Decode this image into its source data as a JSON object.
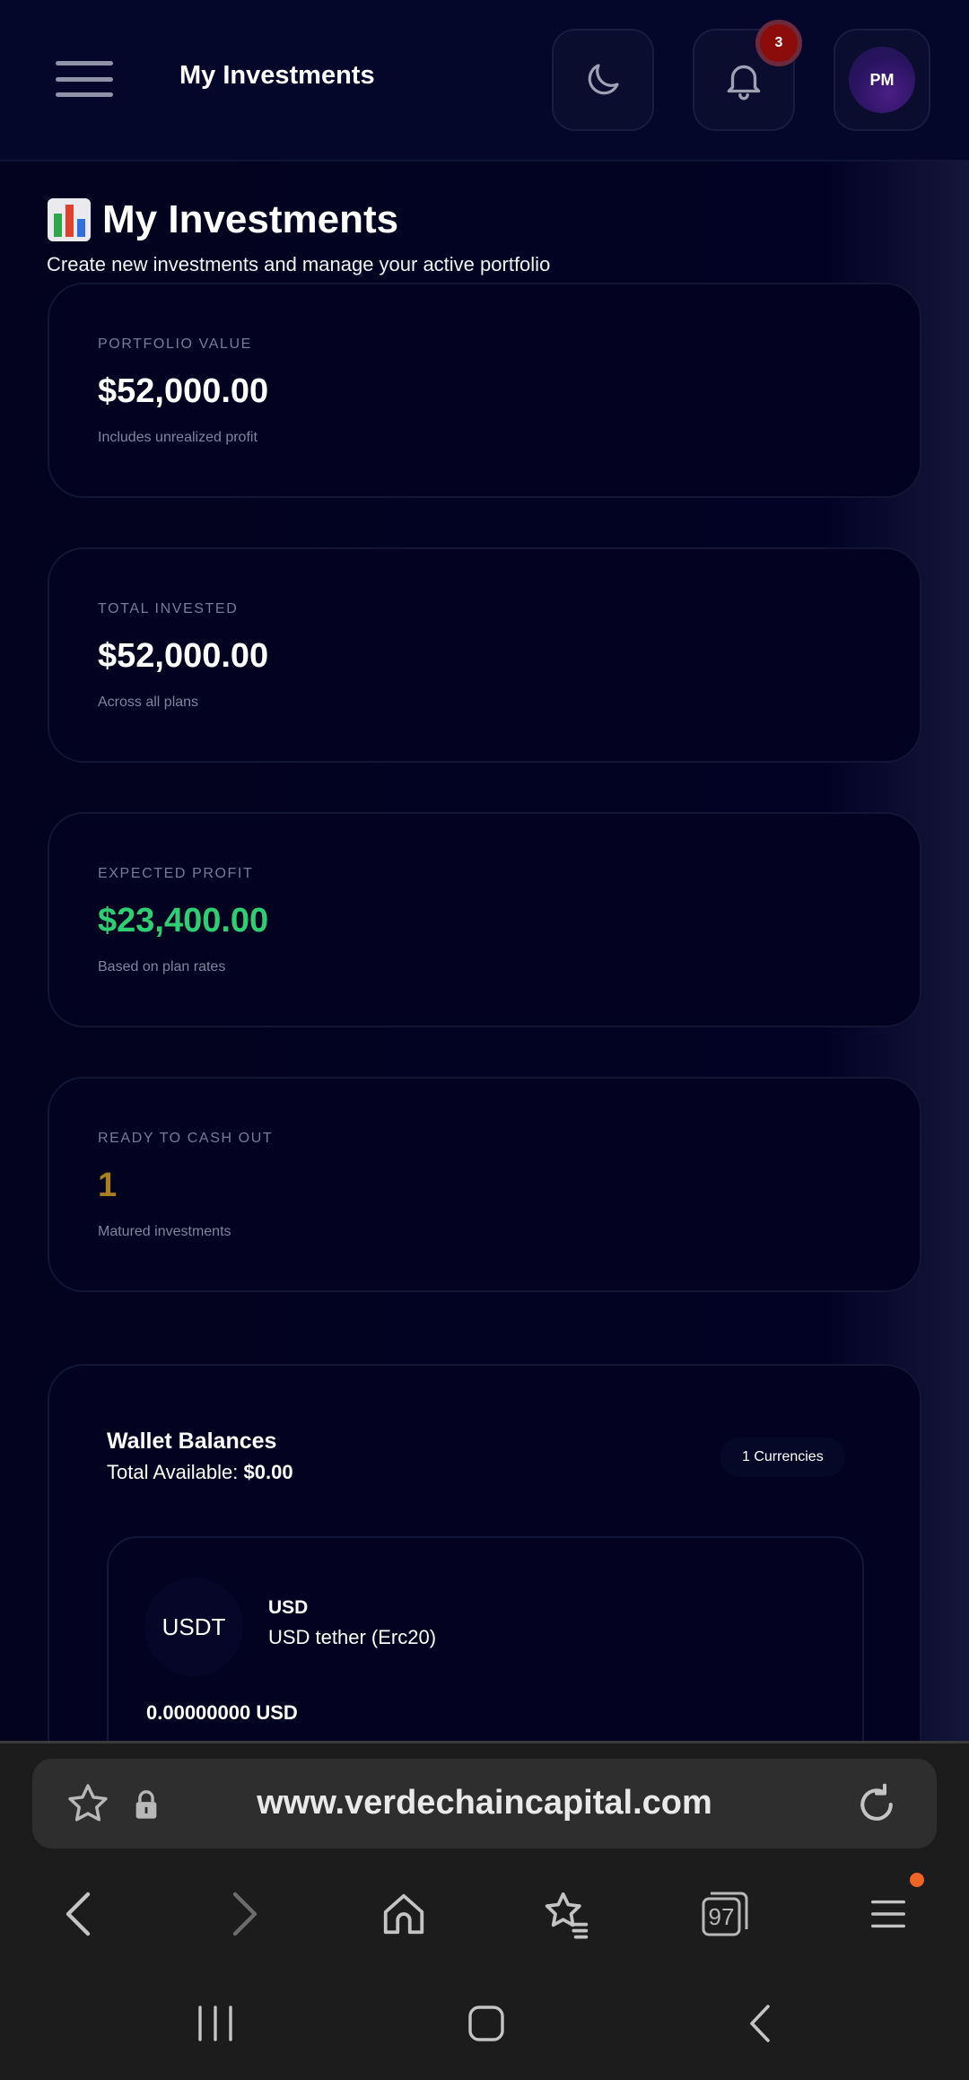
{
  "header": {
    "title": "My Investments",
    "notifications_count": "3",
    "avatar_initials": "PM",
    "icons": [
      "menu-icon",
      "moon-icon",
      "bell-icon"
    ]
  },
  "page": {
    "title": "My Investments",
    "title_emoji": "bar-chart-icon",
    "subtitle": "Create new investments and manage your active portfolio"
  },
  "stats": [
    {
      "label": "PORTFOLIO VALUE",
      "value": "$52,000.00",
      "note": "Includes unrealized profit",
      "color": "#ffffff"
    },
    {
      "label": "TOTAL INVESTED",
      "value": "$52,000.00",
      "note": "Across all plans",
      "color": "#ffffff"
    },
    {
      "label": "EXPECTED PROFIT",
      "value": "$23,400.00",
      "note": "Based on plan rates",
      "color": "#2ecf72"
    },
    {
      "label": "READY TO CASH OUT",
      "value": "1",
      "note": "Matured investments",
      "color": "#a8801e"
    }
  ],
  "wallet": {
    "title": "Wallet Balances",
    "total_label": "Total Available:",
    "total_value": "$0.00",
    "currency_count": "1 Currencies",
    "assets": [
      {
        "icon_text": "USDT",
        "code": "USD",
        "name": "USD tether (Erc20)",
        "balance": "0.00000000 USD"
      }
    ]
  },
  "browser": {
    "url": "www.verdechaincapital.com",
    "tabs_count": "97",
    "icons": [
      "bookmark-star-icon",
      "lock-icon",
      "reload-icon",
      "back-icon",
      "forward-icon",
      "home-icon",
      "bookmarks-icon",
      "tabs-icon",
      "menu-icon"
    ]
  }
}
